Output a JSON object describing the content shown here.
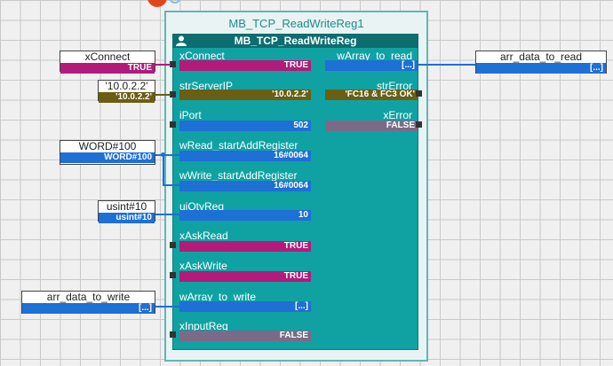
{
  "instance_name": "MB_TCP_ReadWriteReg1",
  "block_type": "MB_TCP_ReadWriteReg",
  "inputs": [
    {
      "name": "xConnect",
      "value": "TRUE"
    },
    {
      "name": "strServerIP",
      "value": "'10.0.2.2'"
    },
    {
      "name": "iPort",
      "value": "502"
    },
    {
      "name": "wRead_startAddRegister",
      "value": "16#0064"
    },
    {
      "name": "wWrite_startAddRegister",
      "value": "16#0064"
    },
    {
      "name": "uiQtyReg",
      "value": "10"
    },
    {
      "name": "xAskRead",
      "value": "TRUE"
    },
    {
      "name": "xAskWrite",
      "value": "TRUE"
    },
    {
      "name": "wArray_to_write",
      "value": "[...]"
    },
    {
      "name": "xInputReg",
      "value": "FALSE"
    }
  ],
  "outputs": [
    {
      "name": "wArray_to_read",
      "value": "[...]"
    },
    {
      "name": "strError",
      "value": "'FC16 & FC3 OK'"
    },
    {
      "name": "xError",
      "value": "FALSE"
    }
  ],
  "connections": [
    {
      "label": "xConnect",
      "value": "TRUE"
    },
    {
      "label": "'10.0.2.2'",
      "value": "'10.0.2.2'"
    },
    {
      "label": "WORD#100",
      "value": "WORD#100"
    },
    {
      "label": "usint#10",
      "value": "usint#10"
    },
    {
      "label": "arr_data_to_write",
      "value": "[...]"
    },
    {
      "label": "arr_data_to_read",
      "value": "[...]"
    }
  ],
  "colors": {
    "bool": "#b21b7b",
    "array": "#1e6fd6",
    "string": "#6b5e13",
    "false_bool": "#7c6a88",
    "block": "#10a2a2",
    "block_header": "#0e6d6f"
  }
}
